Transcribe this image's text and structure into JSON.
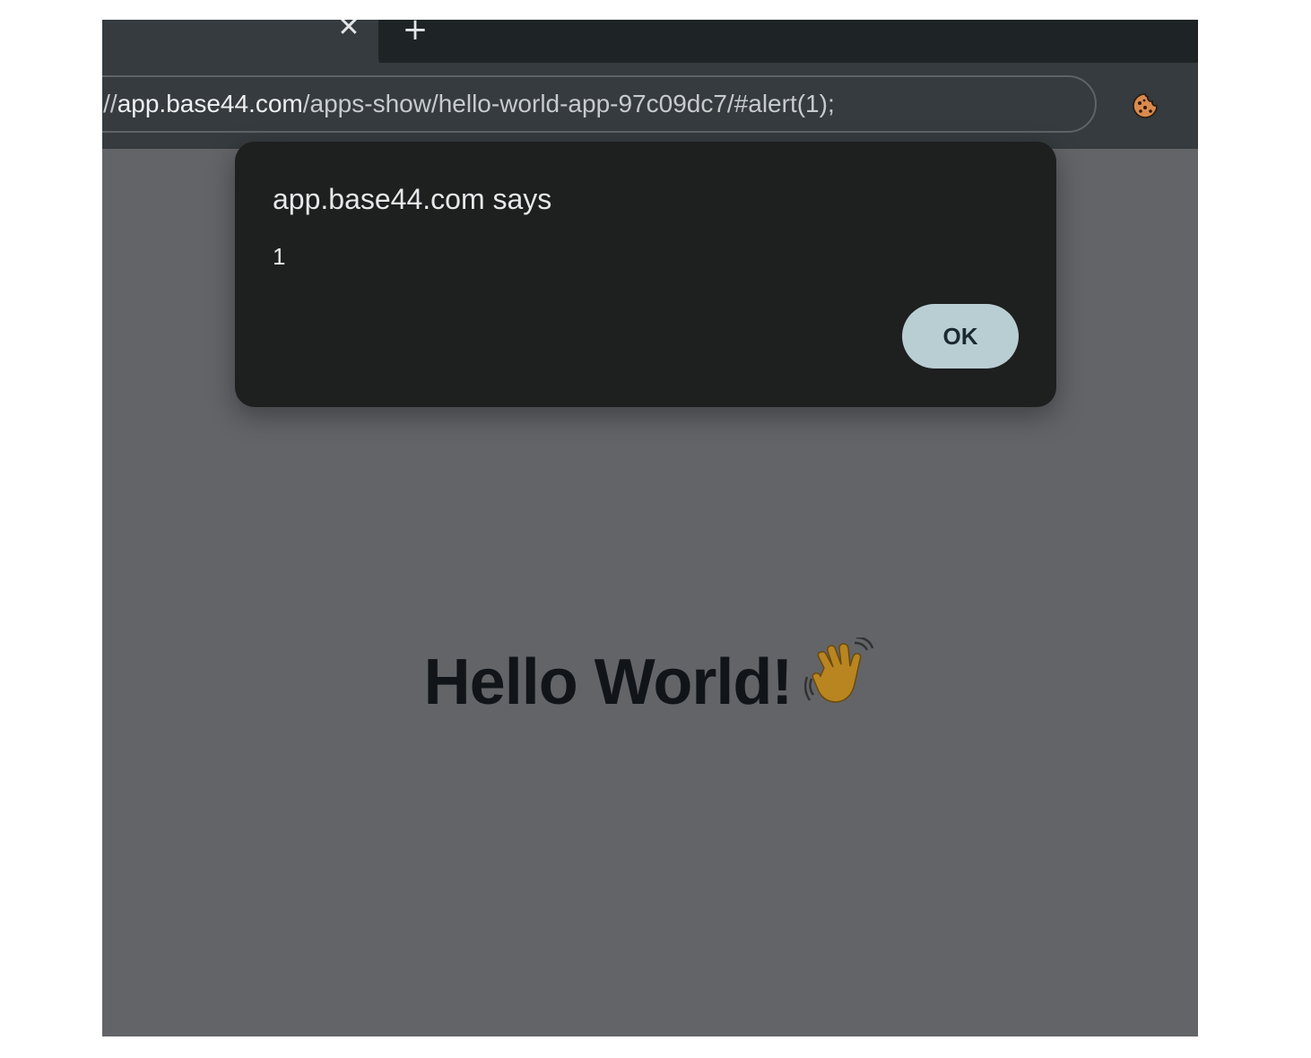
{
  "browser": {
    "tab": {
      "close_glyph": "✕",
      "new_tab_glyph": "+"
    },
    "address_bar": {
      "url_scheme_partial": "tps://",
      "url_host": "app.base44.com",
      "url_path": "/apps-show/hello-world-app-97c09dc7/#alert(1);"
    },
    "toolbar_icons": [
      "cookie-icon"
    ]
  },
  "page": {
    "heading": "Hello World!",
    "heading_emoji_icon": "waving-hand-icon"
  },
  "dialog": {
    "title": "app.base44.com says",
    "message": "1",
    "ok_label": "OK"
  },
  "colors": {
    "dialog_background": "#1e1f1f",
    "ok_button": "#b9ced3",
    "page_overlay": "#636468",
    "toolbar": "#353b3e",
    "tabstrip": "#1e2326"
  }
}
